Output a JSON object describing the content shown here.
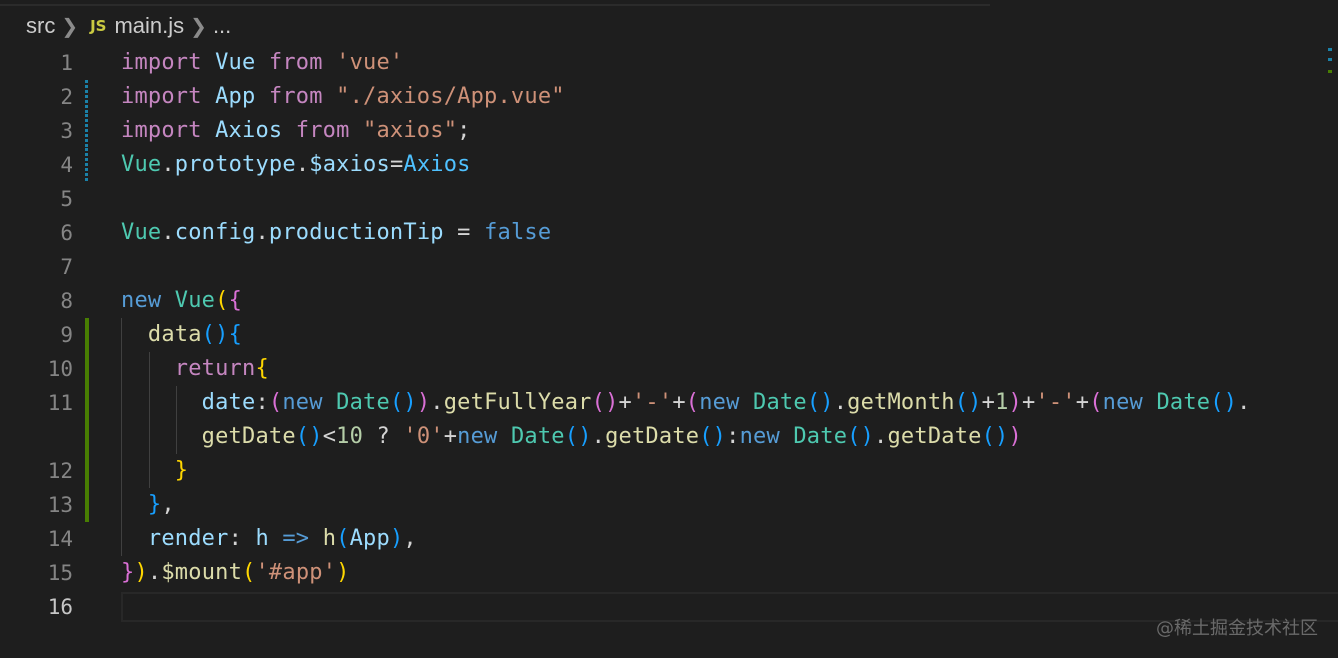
{
  "breadcrumb": {
    "folder": "src",
    "file_icon": "JS",
    "file": "main.js",
    "more": "..."
  },
  "lines": [
    {
      "num": "1",
      "tokens": [
        [
          "import",
          "k"
        ],
        [
          " Vue ",
          "v"
        ],
        [
          "from",
          "k"
        ],
        [
          " ",
          "p"
        ],
        [
          "'vue'",
          "s"
        ]
      ]
    },
    {
      "num": "2",
      "tokens": [
        [
          "import",
          "k"
        ],
        [
          " App ",
          "v"
        ],
        [
          "from",
          "k"
        ],
        [
          " ",
          "p"
        ],
        [
          "\"./axios/App.vue\"",
          "s"
        ]
      ]
    },
    {
      "num": "3",
      "tokens": [
        [
          "import",
          "k"
        ],
        [
          " Axios ",
          "v"
        ],
        [
          "from",
          "k"
        ],
        [
          " ",
          "p"
        ],
        [
          "\"axios\"",
          "s"
        ],
        [
          ";",
          "p"
        ]
      ]
    },
    {
      "num": "4",
      "tokens": [
        [
          "Vue",
          "t"
        ],
        [
          ".",
          "p"
        ],
        [
          "prototype",
          "v"
        ],
        [
          ".",
          "p"
        ],
        [
          "$axios",
          "v"
        ],
        [
          "=",
          "p"
        ],
        [
          "Axios",
          "c"
        ]
      ]
    },
    {
      "num": "5",
      "tokens": []
    },
    {
      "num": "6",
      "tokens": [
        [
          "Vue",
          "t"
        ],
        [
          ".",
          "p"
        ],
        [
          "config",
          "v"
        ],
        [
          ".",
          "p"
        ],
        [
          "productionTip",
          "v"
        ],
        [
          " = ",
          "p"
        ],
        [
          "false",
          "kb"
        ]
      ]
    },
    {
      "num": "7",
      "tokens": []
    },
    {
      "num": "8",
      "tokens": [
        [
          "new",
          "kb"
        ],
        [
          " ",
          "p"
        ],
        [
          "Vue",
          "t"
        ],
        [
          "(",
          "b1"
        ],
        [
          "{",
          "b2"
        ]
      ]
    },
    {
      "num": "9",
      "tokens": [
        [
          "  ",
          "p"
        ],
        [
          "data",
          "f"
        ],
        [
          "()",
          "b3"
        ],
        [
          "{",
          "b3"
        ]
      ]
    },
    {
      "num": "10",
      "tokens": [
        [
          "    ",
          "p"
        ],
        [
          "return",
          "k"
        ],
        [
          "{",
          "b1"
        ]
      ]
    },
    {
      "num": "11",
      "tokens": [
        [
          "      ",
          "p"
        ],
        [
          "date",
          "v"
        ],
        [
          ":",
          "p"
        ],
        [
          "(",
          "b2"
        ],
        [
          "new",
          "kb"
        ],
        [
          " ",
          "p"
        ],
        [
          "Date",
          "t"
        ],
        [
          "()",
          "b3"
        ],
        [
          ")",
          "b2"
        ],
        [
          ".",
          "p"
        ],
        [
          "getFullYear",
          "f"
        ],
        [
          "()",
          "b2"
        ],
        [
          "+",
          "p"
        ],
        [
          "'-'",
          "s"
        ],
        [
          "+",
          "p"
        ],
        [
          "(",
          "b2"
        ],
        [
          "new",
          "kb"
        ],
        [
          " ",
          "p"
        ],
        [
          "Date",
          "t"
        ],
        [
          "()",
          "b3"
        ],
        [
          ".",
          "p"
        ],
        [
          "getMonth",
          "f"
        ],
        [
          "()",
          "b3"
        ],
        [
          "+",
          "p"
        ],
        [
          "1",
          "n"
        ],
        [
          ")",
          "b2"
        ],
        [
          "+",
          "p"
        ],
        [
          "'-'",
          "s"
        ],
        [
          "+",
          "p"
        ],
        [
          "(",
          "b2"
        ],
        [
          "new",
          "kb"
        ],
        [
          " ",
          "p"
        ],
        [
          "Date",
          "t"
        ],
        [
          "()",
          "b3"
        ],
        [
          ".",
          "p"
        ]
      ]
    },
    {
      "num": "",
      "tokens": [
        [
          "      ",
          "p"
        ],
        [
          "getDate",
          "f"
        ],
        [
          "()",
          "b3"
        ],
        [
          "<",
          "p"
        ],
        [
          "10",
          "n"
        ],
        [
          " ? ",
          "p"
        ],
        [
          "'0'",
          "s"
        ],
        [
          "+",
          "p"
        ],
        [
          "new",
          "kb"
        ],
        [
          " ",
          "p"
        ],
        [
          "Date",
          "t"
        ],
        [
          "()",
          "b3"
        ],
        [
          ".",
          "p"
        ],
        [
          "getDate",
          "f"
        ],
        [
          "()",
          "b3"
        ],
        [
          ":",
          "p"
        ],
        [
          "new",
          "kb"
        ],
        [
          " ",
          "p"
        ],
        [
          "Date",
          "t"
        ],
        [
          "()",
          "b3"
        ],
        [
          ".",
          "p"
        ],
        [
          "getDate",
          "f"
        ],
        [
          "()",
          "b3"
        ],
        [
          ")",
          "b2"
        ]
      ]
    },
    {
      "num": "12",
      "tokens": [
        [
          "    ",
          "p"
        ],
        [
          "}",
          "b1"
        ]
      ]
    },
    {
      "num": "13",
      "tokens": [
        [
          "  ",
          "p"
        ],
        [
          "}",
          "b3"
        ],
        [
          ",",
          "p"
        ]
      ]
    },
    {
      "num": "14",
      "tokens": [
        [
          "  ",
          "p"
        ],
        [
          "render",
          "v"
        ],
        [
          ": ",
          "p"
        ],
        [
          "h",
          "v"
        ],
        [
          " ",
          "p"
        ],
        [
          "=>",
          "kb"
        ],
        [
          " ",
          "p"
        ],
        [
          "h",
          "f"
        ],
        [
          "(",
          "b3"
        ],
        [
          "App",
          "v"
        ],
        [
          ")",
          "b3"
        ],
        [
          ",",
          "p"
        ]
      ]
    },
    {
      "num": "15",
      "tokens": [
        [
          "}",
          "b2"
        ],
        [
          ")",
          "b1"
        ],
        [
          ".",
          "p"
        ],
        [
          "$mount",
          "f"
        ],
        [
          "(",
          "b1"
        ],
        [
          "'#app'",
          "s"
        ],
        [
          ")",
          "b1"
        ]
      ]
    },
    {
      "num": "16",
      "tokens": []
    }
  ],
  "watermark": "@稀土掘金技术社区"
}
